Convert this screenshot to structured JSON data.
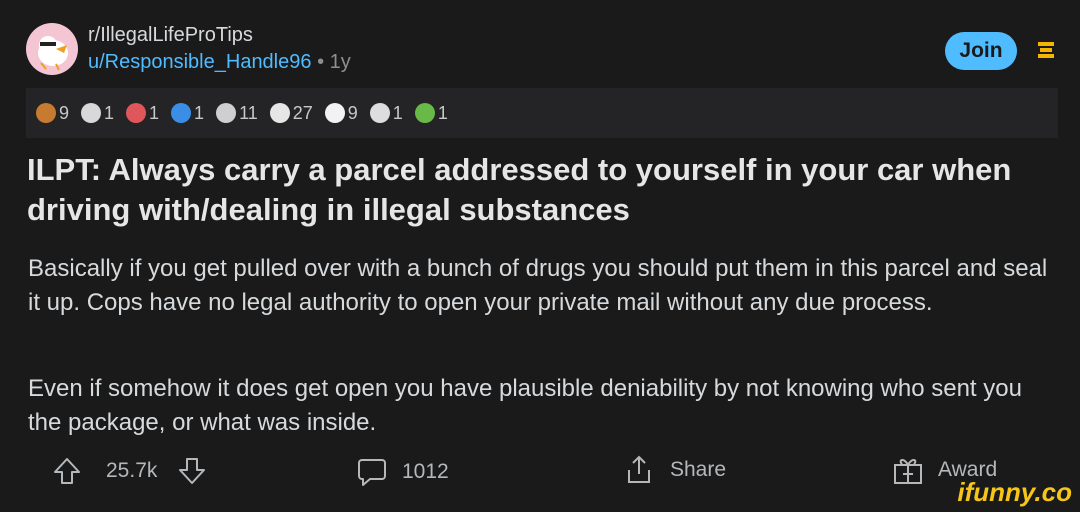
{
  "post": {
    "subreddit": "r/IllegalLifeProTips",
    "author": "u/Responsible_Handle96",
    "separator": "•",
    "age": "1y",
    "join_label": "Join",
    "title": "ILPT: Always carry a parcel addressed to yourself in your car when driving with/dealing in illegal substances",
    "paragraphs": [
      "Basically if you get pulled over with a bunch of drugs you should put them in this parcel and seal it up. Cops have no legal authority to open your private mail without any due process.",
      "Even if somehow it does get open you have plausible deniability by not knowing who sent you the package, or what was inside."
    ]
  },
  "awards": [
    {
      "icon": "award-icon",
      "count": "9",
      "color": "#c77b30"
    },
    {
      "icon": "award-icon",
      "count": "1",
      "color": "#d8d8d8"
    },
    {
      "icon": "award-icon",
      "count": "1",
      "color": "#e0575b"
    },
    {
      "icon": "award-icon",
      "count": "1",
      "color": "#3a8ee6"
    },
    {
      "icon": "award-icon",
      "count": "11",
      "color": "#cfcfcf"
    },
    {
      "icon": "award-icon",
      "count": "27",
      "color": "#e6e6e6"
    },
    {
      "icon": "award-icon",
      "count": "9",
      "color": "#f2f2f2"
    },
    {
      "icon": "award-icon",
      "count": "1",
      "color": "#dddddd"
    },
    {
      "icon": "award-icon",
      "count": "1",
      "color": "#68b948"
    }
  ],
  "actions": {
    "upvotes": "25.7k",
    "comments": "1012",
    "share": "Share",
    "award": "Award"
  },
  "watermark": "ifunny.co"
}
